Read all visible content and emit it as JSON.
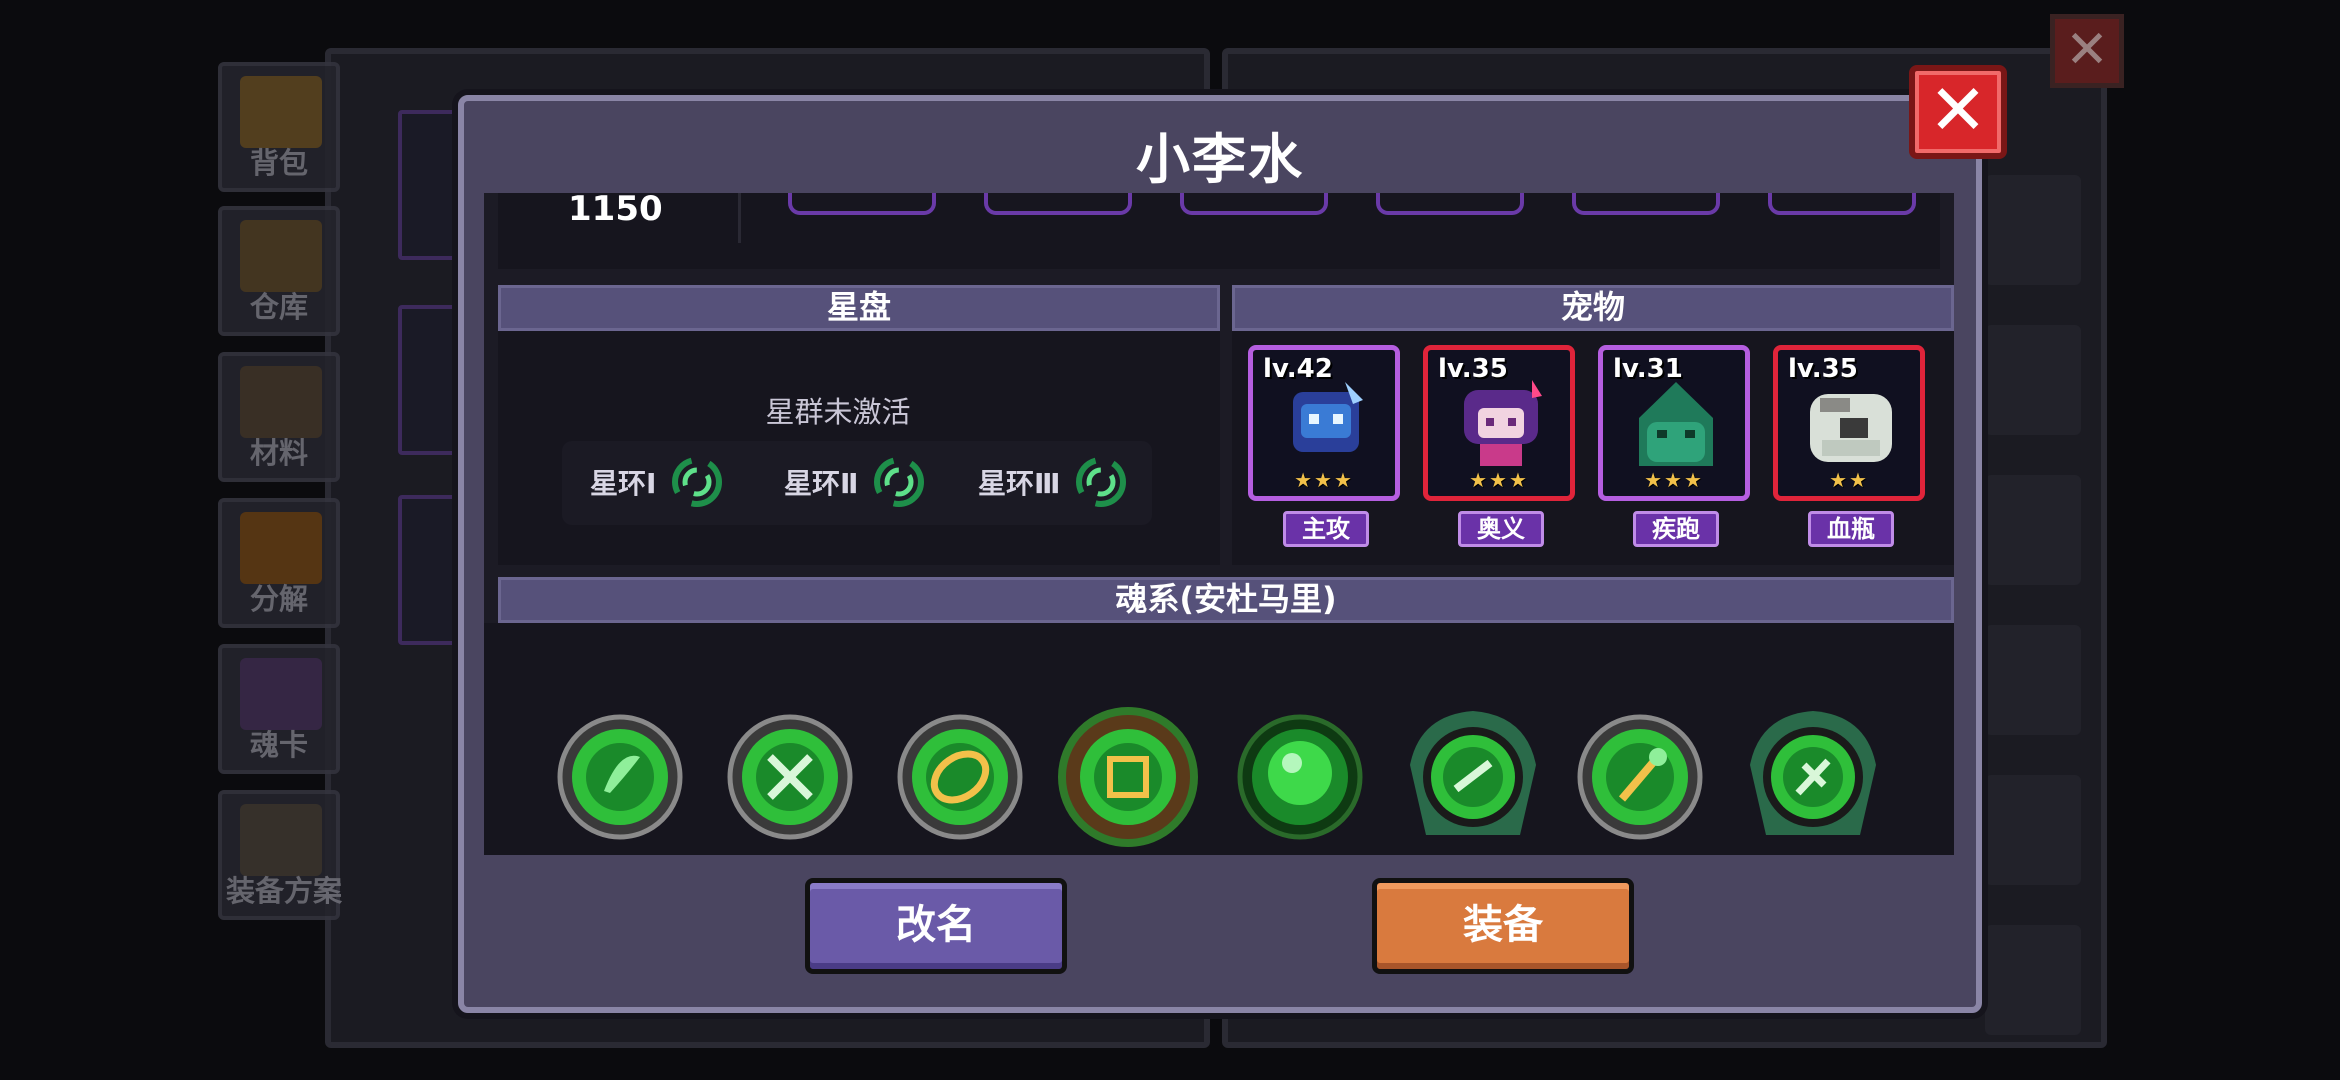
{
  "background": {
    "side_tabs": [
      {
        "label": "背包"
      },
      {
        "label": "仓库"
      },
      {
        "label": "材料"
      },
      {
        "label": "分解"
      },
      {
        "label": "魂卡"
      },
      {
        "label": "装备方案"
      }
    ],
    "close_symbol": "✕"
  },
  "modal": {
    "title": "小李水",
    "close_symbol": "✕",
    "stats": {
      "value": "1150"
    },
    "star_disc": {
      "header": "星盘",
      "status": "星群未激活",
      "rings": [
        {
          "label": "星环Ⅰ"
        },
        {
          "label": "星环Ⅱ"
        },
        {
          "label": "星环Ⅲ"
        }
      ]
    },
    "pets": {
      "header": "宠物",
      "items": [
        {
          "level": "lv.42",
          "stars": "★★★",
          "tag": "主攻",
          "frame": "purple",
          "color": "#3a7bd5"
        },
        {
          "level": "lv.35",
          "stars": "★★★",
          "tag": "奥义",
          "frame": "red",
          "color": "#9b3fb0"
        },
        {
          "level": "lv.31",
          "stars": "★★★",
          "tag": "疾跑",
          "frame": "purple",
          "color": "#2fa37a"
        },
        {
          "level": "lv.35",
          "stars": "★★",
          "tag": "血瓶",
          "frame": "red",
          "color": "#d9e0d8"
        }
      ]
    },
    "soul": {
      "header": "魂系(安杜马里)",
      "icons": [
        "leaf-soul-icon",
        "cross-soul-icon",
        "gold-ring-soul-icon",
        "vine-rune-soul-icon",
        "orb-soul-icon",
        "dragon-crest-soul-icon",
        "staff-soul-icon",
        "dragon-gem-soul-icon"
      ]
    },
    "buttons": {
      "rename": "改名",
      "equip": "装备"
    }
  },
  "colors": {
    "modal_bg": "#4a4560",
    "header_bg": "#56517a",
    "rename_btn": "#6a5aa8",
    "equip_btn": "#d97a3e",
    "close_btn": "#d8262a",
    "soul_green": "#2fbf3a"
  }
}
